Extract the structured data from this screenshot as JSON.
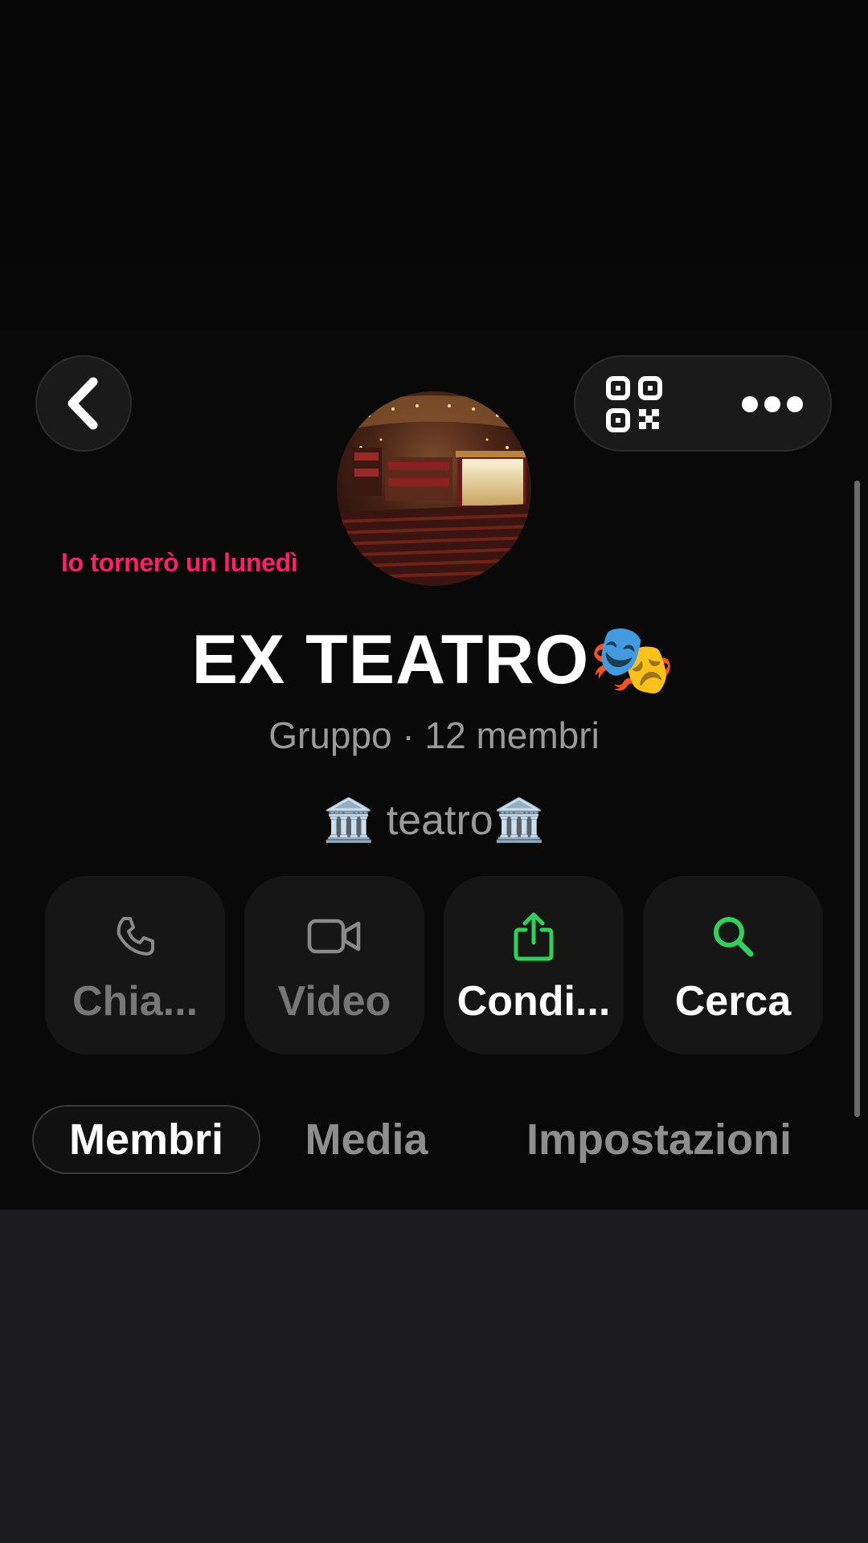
{
  "header": {
    "back_icon": "chevron-left-icon",
    "qr_icon": "qr-code-icon",
    "more_icon": "ellipsis-icon"
  },
  "profile": {
    "status_note": "Io tornerò un lunedì",
    "title": "EX TEATRO🎭",
    "subtitle": "Gruppo · 12 membri",
    "description": "🏛️ teatro🏛️"
  },
  "actions": [
    {
      "label": "Chia...",
      "icon": "phone-icon",
      "enabled": false
    },
    {
      "label": "Video",
      "icon": "video-camera-icon",
      "enabled": false
    },
    {
      "label": "Condi...",
      "icon": "share-icon",
      "enabled": true
    },
    {
      "label": "Cerca",
      "icon": "search-icon",
      "enabled": true
    }
  ],
  "tabs": [
    {
      "label": "Membri",
      "active": true
    },
    {
      "label": "Media",
      "active": false
    },
    {
      "label": "Impostazioni",
      "active": false
    }
  ],
  "colors": {
    "accent_green": "#2fd15c",
    "status_pink": "#ff1f6a",
    "disabled_gray": "#8a8a8a"
  }
}
